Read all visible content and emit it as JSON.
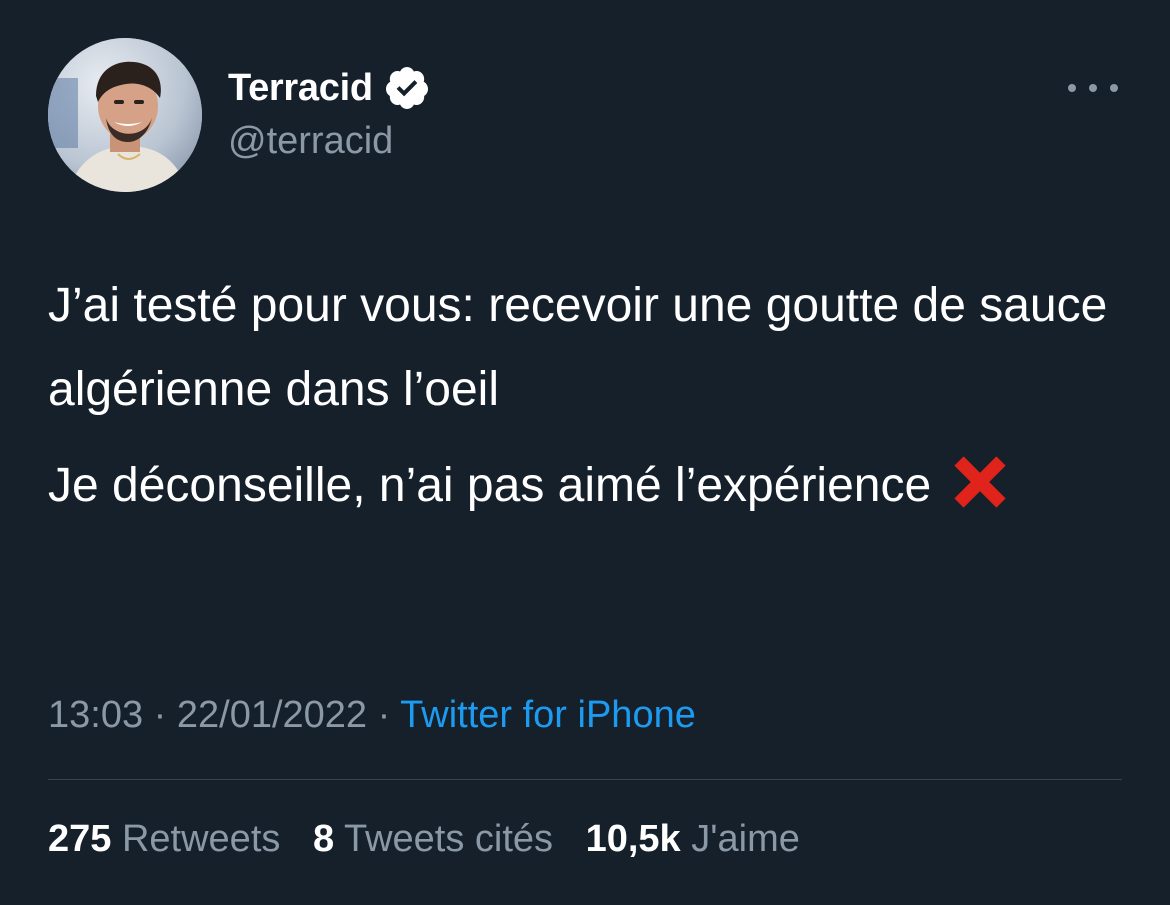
{
  "user": {
    "display_name": "Terracid",
    "handle": "@terracid",
    "verified": true,
    "avatar": "profile-photo"
  },
  "tweet": {
    "paragraph_1": "J’ai testé pour vous: recevoir une goutte de sauce algérienne dans l’oeil",
    "paragraph_2": "Je déconseille, n’ai pas aimé l’expérience",
    "emoji": "❌"
  },
  "meta": {
    "time": "13:03",
    "separator": "·",
    "date": "22/01/2022",
    "source": "Twitter for iPhone"
  },
  "stats": {
    "retweets_count": "275",
    "retweets_label": "Retweets",
    "quotes_count": "8",
    "quotes_label": "Tweets cités",
    "likes_count": "10,5k",
    "likes_label": "J'aime"
  },
  "colors": {
    "background": "#15202b",
    "text": "#ffffff",
    "muted": "#8b98a5",
    "accent": "#1d9bf0",
    "divider": "#38444d"
  }
}
